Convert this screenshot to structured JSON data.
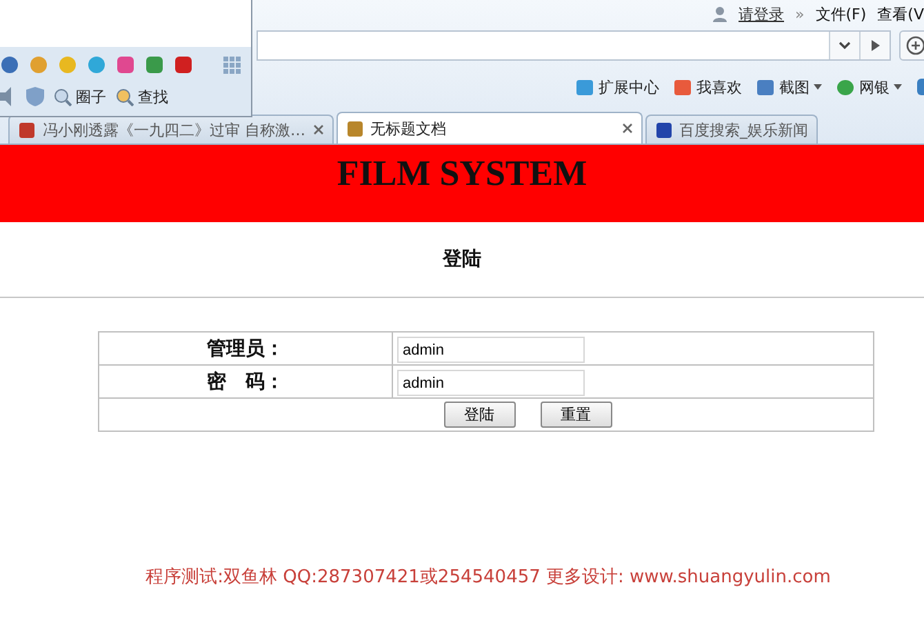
{
  "browser": {
    "menu_bar": {
      "login_link": "请登录",
      "chevron": "»",
      "menus": [
        "文件(F)",
        "查看(V"
      ]
    },
    "toolbar": [
      {
        "label": "扩展中心",
        "dropdown": false
      },
      {
        "label": "我喜欢",
        "dropdown": false
      },
      {
        "label": "截图",
        "dropdown": true
      },
      {
        "label": "网银",
        "dropdown": true
      }
    ],
    "popup": {
      "links": [
        "圈子",
        "查找"
      ]
    },
    "tabs": [
      {
        "title": "冯小刚透露《一九四二》过审 自称激…",
        "selected": false,
        "closable": true
      },
      {
        "title": "无标题文档",
        "selected": true,
        "closable": true
      },
      {
        "title": "百度搜索_娱乐新闻",
        "selected": false,
        "closable": false
      }
    ]
  },
  "page": {
    "banner": "FILM SYSTEM",
    "heading": "登陆",
    "form": {
      "fields": [
        {
          "label": "管理员：",
          "value": "admin"
        },
        {
          "label": "密　码：",
          "value": "admin"
        }
      ],
      "buttons": [
        "登陆",
        "重置"
      ]
    },
    "footer": "程序测试:双鱼林 QQ:287307421或254540457 更多设计: www.shuangyulin.com"
  }
}
